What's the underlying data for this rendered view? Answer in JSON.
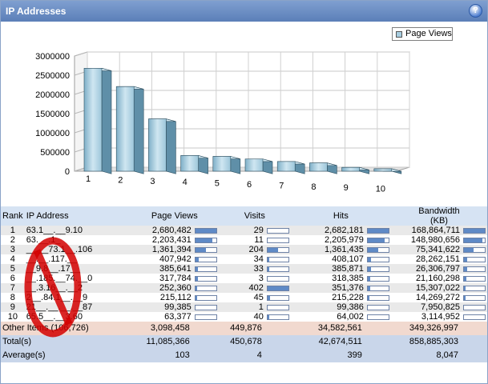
{
  "window": {
    "title": "IP Addresses",
    "help_label": "?"
  },
  "chart_data": {
    "type": "bar",
    "title": "",
    "categories": [
      "1",
      "2",
      "3",
      "4",
      "5",
      "6",
      "7",
      "8",
      "9",
      "10"
    ],
    "series": [
      {
        "name": "Page Views",
        "values": [
          2680482,
          2203431,
          1361394,
          407942,
          385641,
          317784,
          252360,
          215112,
          99385,
          63377
        ]
      }
    ],
    "y_ticks": [
      "0",
      "500000",
      "1000000",
      "1500000",
      "2000000",
      "2500000",
      "3000000"
    ],
    "ylim": [
      0,
      3000000
    ],
    "grid": true,
    "legend_placement": "top-right",
    "bar_color": "#a7cde0"
  },
  "table": {
    "headers": {
      "rank": "Rank",
      "ip": "IP Address",
      "page_views": "Page Views",
      "visits": "Visits",
      "hits": "Hits",
      "bandwidth": "Bandwidth",
      "bandwidth_unit": "(KB)"
    },
    "rows": [
      {
        "rank": "1",
        "ip": "63.1__.__9.10",
        "page_views": "2,680,482",
        "pv_frac": 1.0,
        "visits": "29",
        "visits_frac": 0.0,
        "hits": "2,682,181",
        "hits_frac": 1.0,
        "bandwidth": "168,864,711",
        "bw_frac": 1.0
      },
      {
        "rank": "2",
        "ip": "63.__.1_",
        "page_views": "2,203,431",
        "pv_frac": 0.82,
        "visits": "11",
        "visits_frac": 0.0,
        "hits": "2,205,979",
        "hits_frac": 0.82,
        "bandwidth": "148,980,656",
        "bw_frac": 0.88
      },
      {
        "rank": "3",
        "ip": "__.__73.1__.106",
        "page_views": "1,361,394",
        "pv_frac": 0.51,
        "visits": "204",
        "visits_frac": 0.51,
        "hits": "1,361,435",
        "hits_frac": 0.51,
        "bandwidth": "75,341,622",
        "bw_frac": 0.45
      },
      {
        "rank": "4",
        "ip": "__.__.117.__",
        "page_views": "407,942",
        "pv_frac": 0.15,
        "visits": "34",
        "visits_frac": 0.08,
        "hits": "408,107",
        "hits_frac": 0.15,
        "bandwidth": "28,262,151",
        "bw_frac": 0.17
      },
      {
        "rank": "5",
        "ip": "__9.8__.17__",
        "page_views": "385,641",
        "pv_frac": 0.14,
        "visits": "33",
        "visits_frac": 0.08,
        "hits": "385,871",
        "hits_frac": 0.14,
        "bandwidth": "26,306,797",
        "bw_frac": 0.16
      },
      {
        "rank": "6",
        "ip": "__.185.__74.__0",
        "page_views": "317,784",
        "pv_frac": 0.12,
        "visits": "3",
        "visits_frac": 0.0,
        "hits": "318,385",
        "hits_frac": 0.12,
        "bandwidth": "21,160,298",
        "bw_frac": 0.13
      },
      {
        "rank": "7",
        "ip": "__.3.16__.__2",
        "page_views": "252,360",
        "pv_frac": 0.09,
        "visits": "402",
        "visits_frac": 1.0,
        "hits": "351,376",
        "hits_frac": 0.13,
        "bandwidth": "15,307,022",
        "bw_frac": 0.09
      },
      {
        "rank": "8",
        "ip": "2__.84.1__.__9",
        "page_views": "215,112",
        "pv_frac": 0.08,
        "visits": "45",
        "visits_frac": 0.11,
        "hits": "215,228",
        "hits_frac": 0.08,
        "bandwidth": "14,269,272",
        "bw_frac": 0.08
      },
      {
        "rank": "9",
        "ip": "21__.__.__.__87",
        "page_views": "99,385",
        "pv_frac": 0.0,
        "visits": "1",
        "visits_frac": 0.0,
        "hits": "99,386",
        "hits_frac": 0.0,
        "bandwidth": "7,950,825",
        "bw_frac": 0.0
      },
      {
        "rank": "10",
        "ip": "65.5__.__3.60",
        "page_views": "63,377",
        "pv_frac": 0.0,
        "visits": "40",
        "visits_frac": 0.1,
        "hits": "64,002",
        "hits_frac": 0.0,
        "bandwidth": "3,114,952",
        "bw_frac": 0.0
      }
    ],
    "other": {
      "label": "Other Items (106,726)",
      "page_views": "3,098,458",
      "visits": "449,876",
      "hits": "34,582,561",
      "bandwidth": "349,326,997"
    },
    "total": {
      "label": "Total(s)",
      "page_views": "11,085,366",
      "visits": "450,678",
      "hits": "42,674,511",
      "bandwidth": "858,885,303"
    },
    "average": {
      "label": "Average(s)",
      "page_views": "103",
      "visits": "4",
      "hits": "399",
      "bandwidth": "8,047"
    }
  }
}
